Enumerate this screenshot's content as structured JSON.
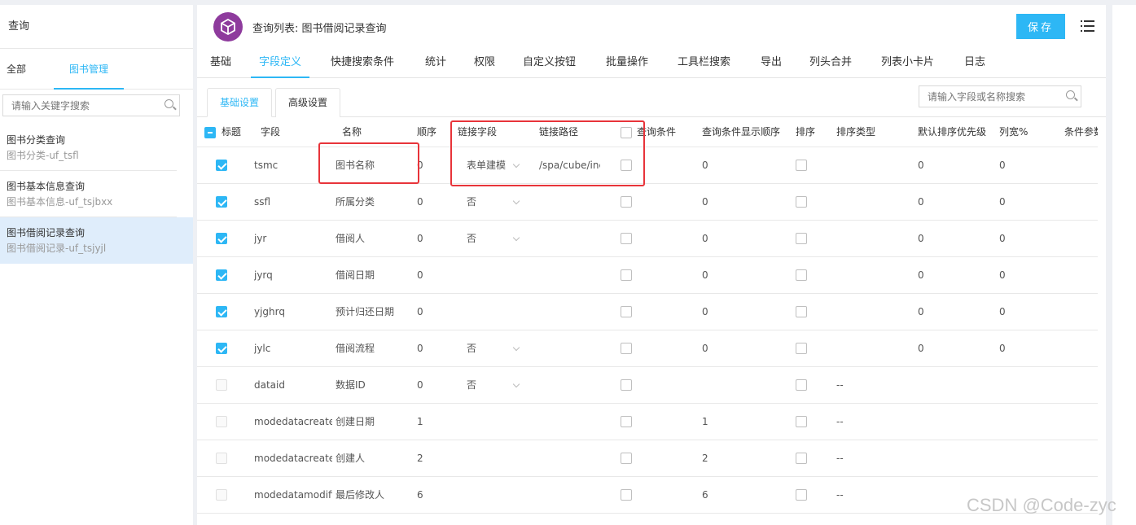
{
  "sidebar": {
    "title": "查询",
    "tabs": [
      "全部",
      "图书管理"
    ],
    "search_placeholder": "请输入关键字搜索",
    "items": [
      {
        "name": "图书分类查询",
        "sub": "图书分类-uf_tsfl"
      },
      {
        "name": "图书基本信息查询",
        "sub": "图书基本信息-uf_tsjbxx"
      },
      {
        "name": "图书借阅记录查询",
        "sub": "图书借阅记录-uf_tsjyjl"
      }
    ]
  },
  "header": {
    "title": "查询列表: 图书借阅记录查询",
    "save_label": "保存",
    "logo_color": "#8e3b9d",
    "accent": "#2db7f5"
  },
  "tabs": [
    "基础",
    "字段定义",
    "快捷搜索条件",
    "统计",
    "权限",
    "自定义按钮",
    "批量操作",
    "工具栏搜索",
    "导出",
    "列头合并",
    "列表小卡片",
    "日志"
  ],
  "subtabs": [
    "基础设置",
    "高级设置"
  ],
  "field_search_placeholder": "请输入字段或名称搜索",
  "table": {
    "columns": [
      "标题",
      "字段",
      "名称",
      "顺序",
      "链接字段",
      "链接路径",
      "查询条件",
      "查询条件显示顺序",
      "排序",
      "排序类型",
      "默认排序优先级",
      "列宽%",
      "条件参数"
    ],
    "rows": [
      {
        "checked": true,
        "field": "tsmc",
        "name": "图书名称",
        "order": "0",
        "link": "表单建模",
        "path": "/spa/cube/inc",
        "query_order": "0",
        "priority": "0",
        "width": "0"
      },
      {
        "checked": true,
        "field": "ssfl",
        "name": "所属分类",
        "order": "0",
        "link": "否",
        "path": "",
        "query_order": "0",
        "priority": "0",
        "width": "0"
      },
      {
        "checked": true,
        "field": "jyr",
        "name": "借阅人",
        "order": "0",
        "link": "否",
        "path": "",
        "query_order": "0",
        "priority": "0",
        "width": "0"
      },
      {
        "checked": true,
        "field": "jyrq",
        "name": "借阅日期",
        "order": "0",
        "link": "",
        "path": "",
        "query_order": "0",
        "priority": "0",
        "width": "0"
      },
      {
        "checked": true,
        "field": "yjghrq",
        "name": "预计归还日期",
        "order": "0",
        "link": "",
        "path": "",
        "query_order": "0",
        "priority": "0",
        "width": "0"
      },
      {
        "checked": true,
        "field": "jylc",
        "name": "借阅流程",
        "order": "0",
        "link": "否",
        "path": "",
        "query_order": "0",
        "priority": "0",
        "width": "0"
      },
      {
        "checked": false,
        "field": "dataid",
        "name": "数据ID",
        "order": "0",
        "link": "否",
        "path": "",
        "query_order": "",
        "sort_type": "--",
        "priority": "",
        "width": ""
      },
      {
        "checked": false,
        "field": "modedatacreatedate",
        "name": "创建日期",
        "order": "1",
        "link": "",
        "path": "",
        "query_order": "1",
        "sort_type": "--",
        "priority": "",
        "width": ""
      },
      {
        "checked": false,
        "field": "modedatacreater",
        "name": "创建人",
        "order": "2",
        "link": "",
        "path": "",
        "query_order": "2",
        "sort_type": "--",
        "priority": "",
        "width": ""
      },
      {
        "checked": false,
        "field": "modedatamodifier",
        "name": "最后修改人",
        "order": "6",
        "link": "",
        "path": "",
        "query_order": "6",
        "sort_type": "--",
        "priority": "",
        "width": ""
      }
    ]
  },
  "watermark": "CSDN @Code-zyc",
  "highlight_color": "#e8343a"
}
